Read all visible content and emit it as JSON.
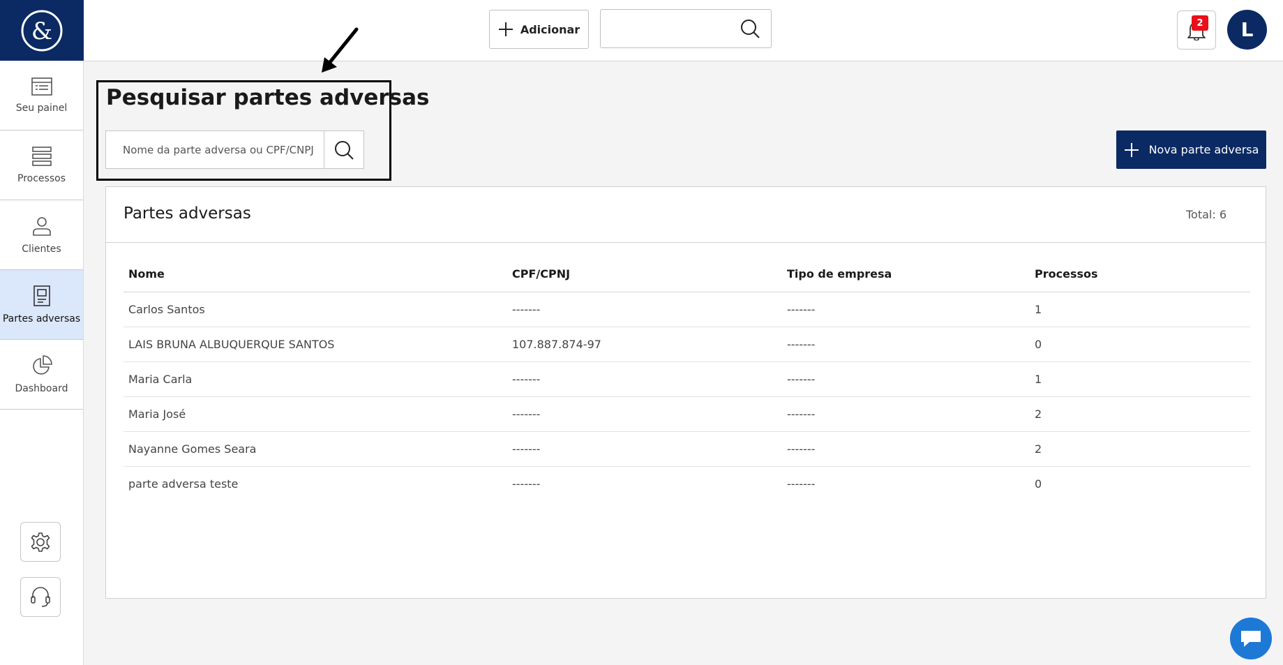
{
  "sidebar": {
    "items": [
      {
        "label": "Seu painel",
        "icon": "dashboard-list-icon"
      },
      {
        "label": "Processos",
        "icon": "stack-icon"
      },
      {
        "label": "Clientes",
        "icon": "user-icon"
      },
      {
        "label": "Partes adversas",
        "icon": "document-icon"
      },
      {
        "label": "Dashboard",
        "icon": "pie-chart-icon"
      }
    ]
  },
  "topbar": {
    "add_label": "Adicionar",
    "search_placeholder": "",
    "notification_count": "2",
    "avatar_initial": "L"
  },
  "page": {
    "title": "Pesquisar partes adversas",
    "search_placeholder": "Nome da parte adversa ou CPF/CNPJ",
    "new_button_label": "Nova parte adversa"
  },
  "card": {
    "title": "Partes adversas",
    "total": "Total: 6"
  },
  "table": {
    "headers": [
      "Nome",
      "CPF/CPNJ",
      "Tipo de empresa",
      "Processos"
    ],
    "rows": [
      [
        "Carlos Santos",
        "-------",
        "-------",
        "1"
      ],
      [
        "LAIS BRUNA ALBUQUERQUE SANTOS",
        "107.887.874-97",
        "-------",
        "0"
      ],
      [
        "Maria Carla",
        "-------",
        "-------",
        "1"
      ],
      [
        "Maria José",
        "-------",
        "-------",
        "2"
      ],
      [
        "Nayanne Gomes Seara",
        "-------",
        "-------",
        "2"
      ],
      [
        "parte adversa teste",
        "-------",
        "-------",
        "0"
      ]
    ]
  },
  "colors": {
    "brand_navy": "#0b2a63",
    "active_nav": "#dbe7fb",
    "badge_red": "#e8101a",
    "chat_blue": "#1e78d6"
  }
}
